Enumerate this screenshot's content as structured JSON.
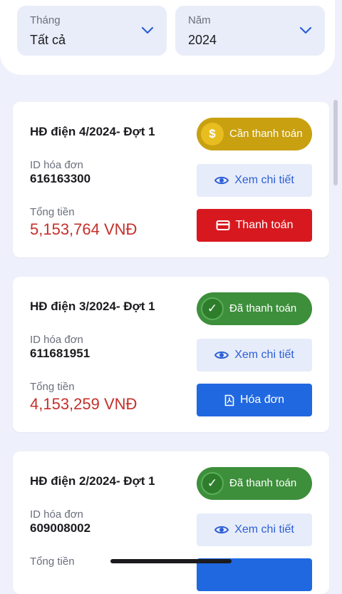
{
  "filters": {
    "month": {
      "label": "Tháng",
      "value": "Tất cả"
    },
    "year": {
      "label": "Năm",
      "value": "2024"
    }
  },
  "bills": [
    {
      "title": "HĐ điện 4/2024- Đợt 1",
      "status": "Cần thanh toán",
      "status_icon": "dollar-icon",
      "id_label": "ID hóa đơn",
      "id_value": "616163300",
      "total_label": "Tổng tiền",
      "total_value": "5,153,764 VNĐ",
      "detail_label": "Xem chi tiết",
      "action_label": "Thanh toán"
    },
    {
      "title": "HĐ điện 3/2024- Đợt 1",
      "status": "Đã thanh toán",
      "status_icon": "check-icon",
      "id_label": "ID hóa đơn",
      "id_value": "611681951",
      "total_label": "Tổng tiền",
      "total_value": "4,153,259 VNĐ",
      "detail_label": "Xem chi tiết",
      "action_label": "Hóa đơn"
    },
    {
      "title": "HĐ điện 2/2024- Đợt 1",
      "status": "Đã thanh toán",
      "status_icon": "check-icon",
      "id_label": "ID hóa đơn",
      "id_value": "609008002",
      "total_label": "Tổng tiền",
      "detail_label": "Xem chi tiết"
    }
  ],
  "colors": {
    "pending": "#c9a010",
    "paid": "#3d8f3b",
    "pay_button": "#d7181f",
    "invoice_button": "#2068e0",
    "amount": "#c4302b"
  }
}
